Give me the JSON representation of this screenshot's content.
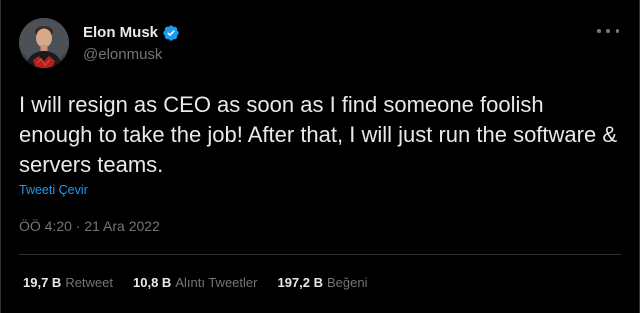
{
  "user": {
    "display_name": "Elon Musk",
    "handle": "@elonmusk",
    "verified": true,
    "avatar_icon": "profile-photo"
  },
  "tweet": {
    "text": "I will resign as CEO as soon as I find someone foolish enough to take the job! After that, I will just run the software & servers teams.",
    "translate_label": "Tweeti Çevir",
    "timestamp": "ÖÖ 4:20 · 21 Ara 2022"
  },
  "stats": [
    {
      "count": "19,7 B",
      "label": "Retweet"
    },
    {
      "count": "10,8 B",
      "label": "Alıntı Tweetler"
    },
    {
      "count": "197,2 B",
      "label": "Beğeni"
    }
  ],
  "colors": {
    "background": "#000000",
    "text": "#e7e9ea",
    "muted": "#71767b",
    "accent": "#1d9bf0",
    "divider": "#2f3336"
  },
  "icons": {
    "verified": "verified-badge-icon",
    "more": "more-options-icon"
  }
}
